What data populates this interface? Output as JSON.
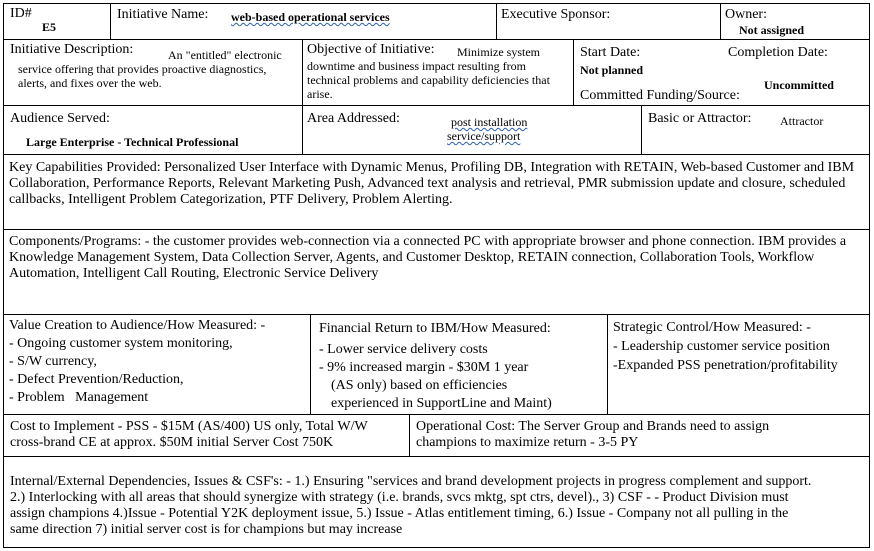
{
  "row1": {
    "id_label": "ID#",
    "id_value": "E5",
    "initiative_label": "Initiative Name:",
    "initiative_value": "web-based operational services",
    "sponsor_label": "Executive Sponsor:",
    "owner_label": "Owner:",
    "owner_value": "Not assigned"
  },
  "row2": {
    "description_label": "Initiative Description:",
    "description_value": "An \"entitled\" electronic service offering that provides proactive diagnostics, alerts, and fixes over the web.",
    "objective_label": "Objective of Initiative:",
    "objective_value": "Minimize system downtime and business impact resulting from technical problems and capability deficiencies that arise.",
    "start_label": "Start Date:",
    "start_value": "Not planned",
    "completion_label": "Completion Date:",
    "funding_label": "Committed Funding/Source:",
    "funding_value": "Uncommitted"
  },
  "row3": {
    "audience_label": "Audience Served:",
    "audience_value": "Large Enterprise - Technical Professional",
    "area_label": "Area Addressed:",
    "area_value_line1": "post installation",
    "area_value_line2": "service/support",
    "basic_label": "Basic or Attractor:",
    "basic_value": "Attractor"
  },
  "capabilities": "Key Capabilities Provided: Personalized User Interface with Dynamic Menus, Profiling DB, Integration with RETAIN, Web-based Customer and IBM Collaboration, Performance Reports, Relevant Marketing Push, Advanced text analysis and retrieval, PMR submission update and closure, scheduled callbacks, Intelligent Problem Categorization, PTF Delivery, Problem Alerting.",
  "components": "Components/Programs: - the customer provides web-connection via a connected PC with appropriate browser and phone connection. IBM provides a Knowledge Management System, Data Collection Server, Agents, and Customer Desktop, RETAIN connection, Collaboration Tools, Workflow Automation, Intelligent Call Routing, Electronic Service Delivery",
  "value_creation": {
    "label": "Value Creation to Audience/How Measured: -",
    "items": [
      "- Ongoing customer system monitoring,",
      "- S/W currency,",
      "- Defect Prevention/Reduction,",
      "- Problem   Management"
    ]
  },
  "financial": {
    "label": "Financial Return to IBM/How Measured:",
    "line1": "- Lower service delivery costs",
    "line2": "- 9% increased margin - $30M 1 year",
    "line3": "(AS only) based on efficiencies",
    "line4": "experienced in SupportLine and Maint)"
  },
  "strategic": {
    "label": "Strategic Control/How Measured: -",
    "line1": "- Leadership customer service position",
    "line2": "-Expanded PSS penetration/profitability"
  },
  "cost": "Cost to Implement - PSS - $15M (AS/400) US only, Total W/W cross-brand CE at approx. $50M initial Server Cost 750K",
  "operational": "Operational Cost:  The Server Group and Brands need to assign champions to maximize return - 3-5 PY",
  "dependencies": "Internal/External Dependencies, Issues & CSF's: - 1.) Ensuring \"services and brand development projects in progress complement and support. 2.)  Interlocking with all areas that should synergize with strategy (i.e. brands, svcs mktg, spt ctrs, devel)., 3) CSF - - Product Division must assign champions 4.)Issue - Potential Y2K deployment issue, 5.) Issue - Atlas entitlement timing, 6.) Issue - Company not all pulling in the same direction    7) initial server cost is for champions but may increase"
}
